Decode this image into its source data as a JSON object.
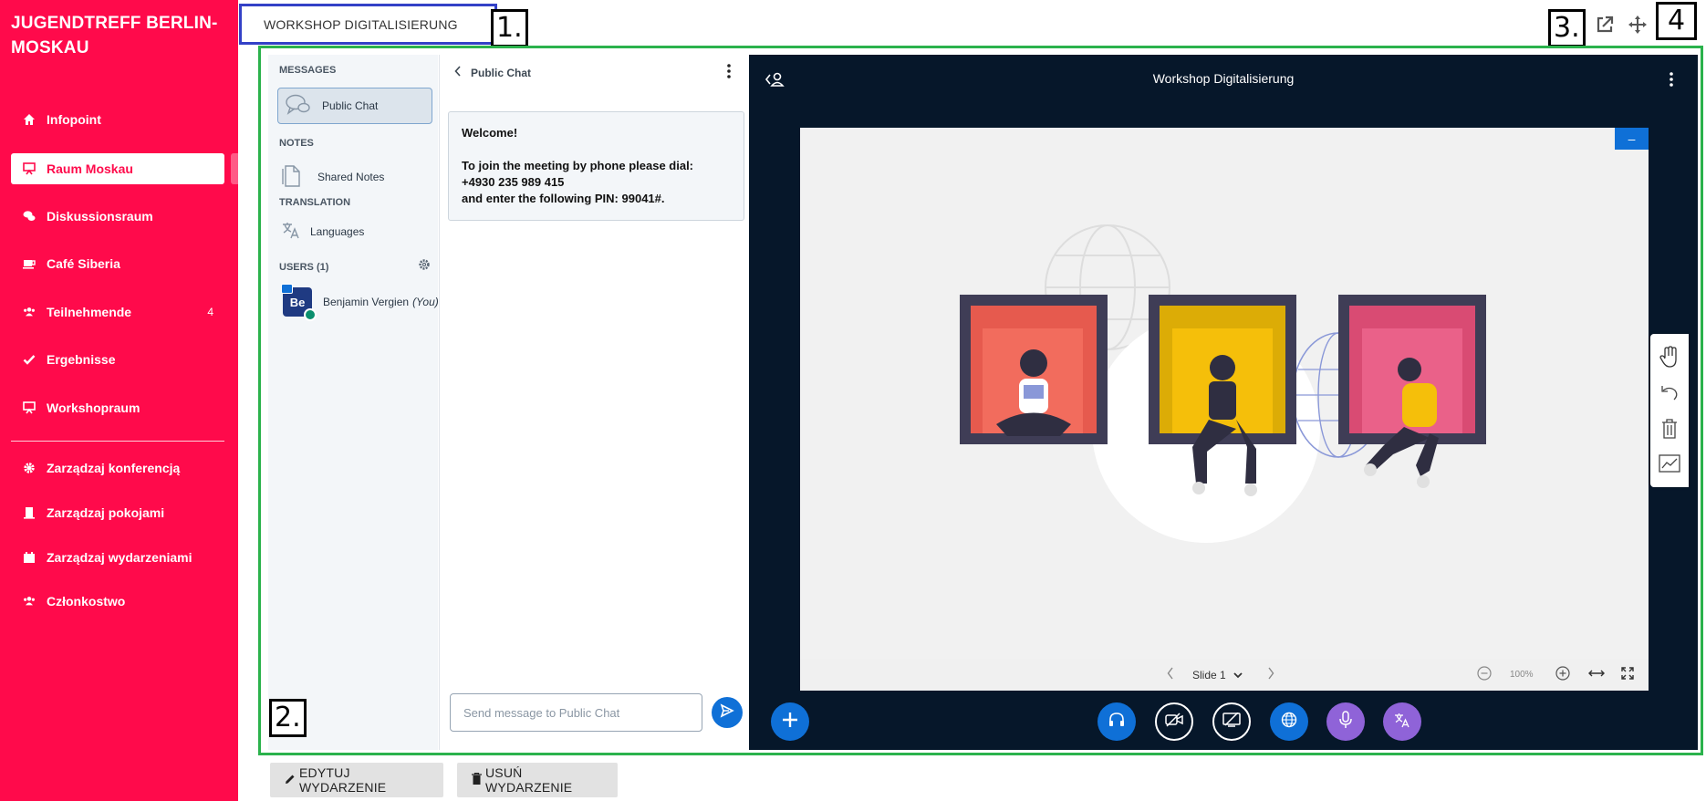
{
  "sidebar": {
    "org_name_line1": "JUGENDTREFF BERLIN-",
    "org_name_line2": "MOSKAU",
    "items": [
      {
        "label": "Infopoint",
        "icon": "home-icon"
      },
      {
        "label": "Raum Moskau",
        "icon": "presentation-icon",
        "active": true
      },
      {
        "label": "Diskussionsraum",
        "icon": "chat-icon"
      },
      {
        "label": "Café Siberia",
        "icon": "coffee-icon"
      },
      {
        "label": "Teilnehmende",
        "icon": "users-icon",
        "count": "4"
      },
      {
        "label": "Ergebnisse",
        "icon": "check-icon"
      },
      {
        "label": "Workshopraum",
        "icon": "presentation-icon"
      }
    ],
    "admin_items": [
      {
        "label": "Zarządzaj konferencją",
        "icon": "gear-icon"
      },
      {
        "label": "Zarządzaj pokojami",
        "icon": "room-icon"
      },
      {
        "label": "Zarządzaj wydarzeniami",
        "icon": "calendar-icon"
      },
      {
        "label": "Członkostwo",
        "icon": "members-icon"
      }
    ],
    "accent_color": "#ff0a4b"
  },
  "tab": {
    "label": "WORKSHOP DIGITALISIERUNG"
  },
  "markers": {
    "m1": "1.",
    "m2": "2.",
    "m3": "3.",
    "m4": "4"
  },
  "panel": {
    "messages_heading": "MESSAGES",
    "public_chat": "Public Chat",
    "notes_heading": "NOTES",
    "shared_notes": "Shared Notes",
    "translation_heading": "TRANSLATION",
    "languages": "Languages",
    "users_heading": "USERS (1)",
    "user_avatar": "Be",
    "user_name": "Benjamin Vergien",
    "user_you": "(You)"
  },
  "chat": {
    "header": "Public Chat",
    "welcome_title": "Welcome!",
    "welcome_line1": "To join the meeting by phone please dial:",
    "welcome_line2": "+4930 235 989 415",
    "welcome_line3": "and enter the following PIN: 99041#.",
    "input_placeholder": "Send message to Public Chat"
  },
  "presentation": {
    "title": "Workshop Digitalisierung",
    "minimize": "–",
    "slide_label": "Slide 1",
    "zoom": "100%"
  },
  "buttons": {
    "edit": "EDYTUJ WYDARZENIE",
    "delete": "USUŃ WYDARZENIE"
  }
}
